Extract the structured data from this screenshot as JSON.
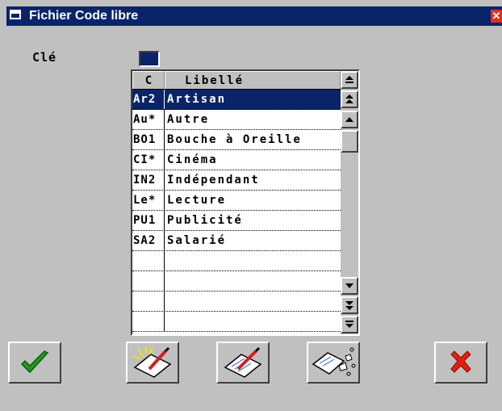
{
  "window": {
    "title": "Fichier Code libre",
    "close_icon": "close-icon"
  },
  "form": {
    "cle_label": "Clé"
  },
  "grid": {
    "columns": [
      "C",
      "Libellé"
    ],
    "rows": [
      {
        "code": "Ar2",
        "libelle": "Artisan",
        "selected": true
      },
      {
        "code": "Au*",
        "libelle": "Autre"
      },
      {
        "code": "BO1",
        "libelle": "Bouche à Oreille"
      },
      {
        "code": "CI*",
        "libelle": "Cinéma"
      },
      {
        "code": "IN2",
        "libelle": "Indépendant"
      },
      {
        "code": "Le*",
        "libelle": "Lecture"
      },
      {
        "code": "PU1",
        "libelle": "Publicité"
      },
      {
        "code": "SA2",
        "libelle": "Salarié"
      },
      {
        "code": "",
        "libelle": ""
      },
      {
        "code": "",
        "libelle": ""
      },
      {
        "code": "",
        "libelle": ""
      },
      {
        "code": "",
        "libelle": ""
      }
    ]
  },
  "toolbar": {
    "buttons": [
      {
        "name": "validate-button",
        "icon": "checkmark-icon"
      },
      {
        "name": "new-button",
        "icon": "new-document-pencil-icon"
      },
      {
        "name": "edit-button",
        "icon": "edit-document-pencil-icon"
      },
      {
        "name": "delete-button",
        "icon": "shred-document-icon"
      },
      {
        "name": "cancel-button",
        "icon": "red-x-icon"
      }
    ]
  },
  "colors": {
    "titlebar": "#0a246a",
    "selection": "#0a246a",
    "face": "#c0c0c0",
    "check_green": "#1f9a1f",
    "x_red": "#e02010"
  }
}
